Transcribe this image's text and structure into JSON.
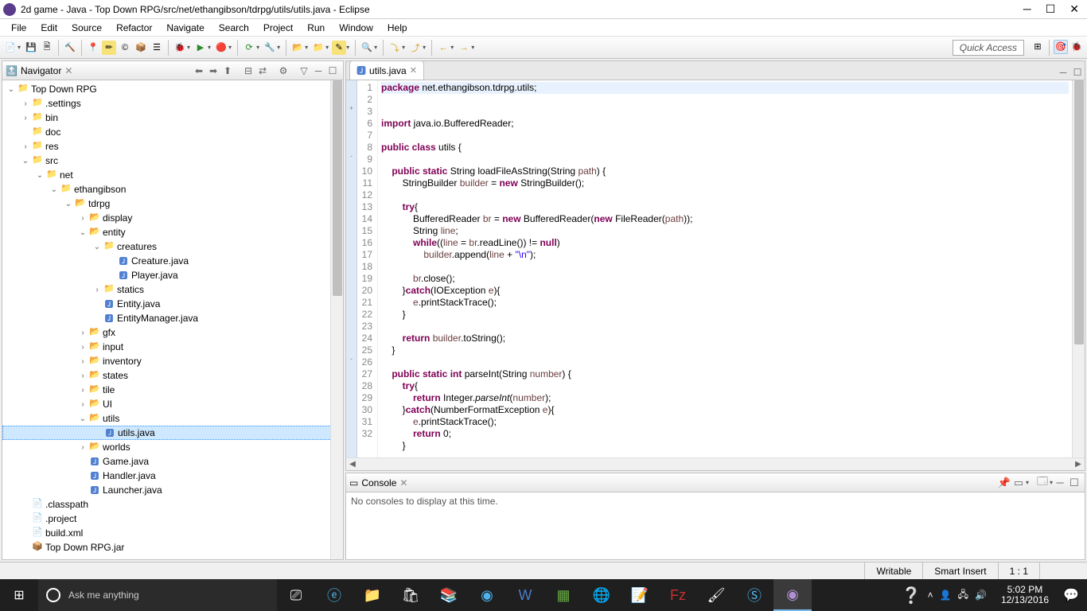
{
  "window": {
    "title": "2d game - Java - Top Down RPG/src/net/ethangibson/tdrpg/utils/utils.java - Eclipse"
  },
  "menu": [
    "File",
    "Edit",
    "Source",
    "Refactor",
    "Navigate",
    "Search",
    "Project",
    "Run",
    "Window",
    "Help"
  ],
  "quick_access": "Quick Access",
  "navigator": {
    "title": "Navigator",
    "tree": [
      {
        "d": 0,
        "tw": "v",
        "ic": "fold",
        "gl": "📁",
        "label": "Top Down RPG"
      },
      {
        "d": 1,
        "tw": ">",
        "ic": "fold",
        "gl": "📁",
        "label": ".settings"
      },
      {
        "d": 1,
        "tw": ">",
        "ic": "fold",
        "gl": "📁",
        "label": "bin"
      },
      {
        "d": 1,
        "tw": "",
        "ic": "fold",
        "gl": "📁",
        "label": "doc"
      },
      {
        "d": 1,
        "tw": ">",
        "ic": "fold",
        "gl": "📁",
        "label": "res"
      },
      {
        "d": 1,
        "tw": "v",
        "ic": "fold",
        "gl": "📁",
        "label": "src"
      },
      {
        "d": 2,
        "tw": "v",
        "ic": "fold",
        "gl": "📁",
        "label": "net"
      },
      {
        "d": 3,
        "tw": "v",
        "ic": "fold",
        "gl": "📁",
        "label": "ethangibson"
      },
      {
        "d": 4,
        "tw": "v",
        "ic": "pkg",
        "gl": "📂",
        "label": "tdrpg"
      },
      {
        "d": 5,
        "tw": ">",
        "ic": "pkg",
        "gl": "📂",
        "label": "display"
      },
      {
        "d": 5,
        "tw": "v",
        "ic": "pkg",
        "gl": "📂",
        "label": "entity"
      },
      {
        "d": 6,
        "tw": "v",
        "ic": "fold",
        "gl": "📁",
        "label": "creatures"
      },
      {
        "d": 7,
        "tw": "",
        "ic": "java",
        "gl": "🅹",
        "label": "Creature.java"
      },
      {
        "d": 7,
        "tw": "",
        "ic": "java",
        "gl": "🅹",
        "label": "Player.java"
      },
      {
        "d": 6,
        "tw": ">",
        "ic": "fold",
        "gl": "📁",
        "label": "statics"
      },
      {
        "d": 6,
        "tw": "",
        "ic": "java",
        "gl": "🅹",
        "label": "Entity.java"
      },
      {
        "d": 6,
        "tw": "",
        "ic": "java",
        "gl": "🅹",
        "label": "EntityManager.java"
      },
      {
        "d": 5,
        "tw": ">",
        "ic": "pkg",
        "gl": "📂",
        "label": "gfx"
      },
      {
        "d": 5,
        "tw": ">",
        "ic": "pkg",
        "gl": "📂",
        "label": "input"
      },
      {
        "d": 5,
        "tw": ">",
        "ic": "pkg",
        "gl": "📂",
        "label": "inventory"
      },
      {
        "d": 5,
        "tw": ">",
        "ic": "pkg",
        "gl": "📂",
        "label": "states"
      },
      {
        "d": 5,
        "tw": ">",
        "ic": "pkg",
        "gl": "📂",
        "label": "tile"
      },
      {
        "d": 5,
        "tw": ">",
        "ic": "pkg",
        "gl": "📂",
        "label": "UI"
      },
      {
        "d": 5,
        "tw": "v",
        "ic": "pkg",
        "gl": "📂",
        "label": "utils"
      },
      {
        "d": 6,
        "tw": "",
        "ic": "java",
        "gl": "🅹",
        "label": "utils.java",
        "sel": true
      },
      {
        "d": 5,
        "tw": ">",
        "ic": "pkg",
        "gl": "📂",
        "label": "worlds"
      },
      {
        "d": 5,
        "tw": "",
        "ic": "java",
        "gl": "🅹",
        "label": "Game.java"
      },
      {
        "d": 5,
        "tw": "",
        "ic": "java",
        "gl": "🅹",
        "label": "Handler.java"
      },
      {
        "d": 5,
        "tw": "",
        "ic": "java",
        "gl": "🅹",
        "label": "Launcher.java"
      },
      {
        "d": 1,
        "tw": "",
        "ic": "file",
        "gl": "📄",
        "label": ".classpath"
      },
      {
        "d": 1,
        "tw": "",
        "ic": "file",
        "gl": "📄",
        "label": ".project"
      },
      {
        "d": 1,
        "tw": "",
        "ic": "file",
        "gl": "📄",
        "label": "build.xml"
      },
      {
        "d": 1,
        "tw": "",
        "ic": "file",
        "gl": "📦",
        "label": "Top Down RPG.jar"
      }
    ]
  },
  "editor": {
    "tab": "utils.java",
    "lines": [
      {
        "n": 1,
        "html": "<span class='kw'>package</span> net.ethangibson.tdrpg.utils;",
        "hl": true
      },
      {
        "n": 2,
        "html": ""
      },
      {
        "n": 3,
        "html": "<span class='kw'>import</span> java.io.BufferedReader;",
        "mark": "+"
      },
      {
        "n": 6,
        "html": ""
      },
      {
        "n": 7,
        "html": "<span class='kw'>public class</span> utils {"
      },
      {
        "n": 8,
        "html": ""
      },
      {
        "n": 9,
        "html": "    <span class='kw'>public static</span> String loadFileAsString(String <span class='var'>path</span>) {",
        "mark": "-"
      },
      {
        "n": 10,
        "html": "        StringBuilder <span class='var'>builder</span> = <span class='kw'>new</span> StringBuilder();"
      },
      {
        "n": 11,
        "html": ""
      },
      {
        "n": 12,
        "html": "        <span class='kw'>try</span>{"
      },
      {
        "n": 13,
        "html": "            BufferedReader <span class='var'>br</span> = <span class='kw'>new</span> BufferedReader(<span class='kw'>new</span> FileReader(<span class='var'>path</span>));"
      },
      {
        "n": 14,
        "html": "            String <span class='var'>line</span>;"
      },
      {
        "n": 15,
        "html": "            <span class='kw'>while</span>((<span class='var'>line</span> = <span class='var'>br</span>.readLine()) != <span class='kw'>null</span>)"
      },
      {
        "n": 16,
        "html": "                <span class='var'>builder</span>.append(<span class='var'>line</span> + <span class='str'>\"\\n\"</span>);"
      },
      {
        "n": 17,
        "html": ""
      },
      {
        "n": 18,
        "html": "            <span class='var'>br</span>.close();"
      },
      {
        "n": 19,
        "html": "        }<span class='kw'>catch</span>(IOException <span class='var'>e</span>){"
      },
      {
        "n": 20,
        "html": "            <span class='var'>e</span>.printStackTrace();"
      },
      {
        "n": 21,
        "html": "        }"
      },
      {
        "n": 22,
        "html": ""
      },
      {
        "n": 23,
        "html": "        <span class='kw'>return</span> <span class='var'>builder</span>.toString();"
      },
      {
        "n": 24,
        "html": "    }"
      },
      {
        "n": 25,
        "html": ""
      },
      {
        "n": 26,
        "html": "    <span class='kw'>public static int</span> parseInt(String <span class='var'>number</span>) {",
        "mark": "-"
      },
      {
        "n": 27,
        "html": "        <span class='kw'>try</span>{"
      },
      {
        "n": 28,
        "html": "            <span class='kw'>return</span> Integer.<span class='mth'>parseInt</span>(<span class='var'>number</span>);"
      },
      {
        "n": 29,
        "html": "        }<span class='kw'>catch</span>(NumberFormatException <span class='var'>e</span>){"
      },
      {
        "n": 30,
        "html": "            <span class='var'>e</span>.printStackTrace();"
      },
      {
        "n": 31,
        "html": "            <span class='kw'>return</span> 0;"
      },
      {
        "n": 32,
        "html": "        }"
      }
    ]
  },
  "console": {
    "title": "Console",
    "message": "No consoles to display at this time."
  },
  "status": {
    "writable": "Writable",
    "insert": "Smart Insert",
    "pos": "1 : 1"
  },
  "taskbar": {
    "search_placeholder": "Ask me anything",
    "time": "5:02 PM",
    "date": "12/13/2016"
  }
}
